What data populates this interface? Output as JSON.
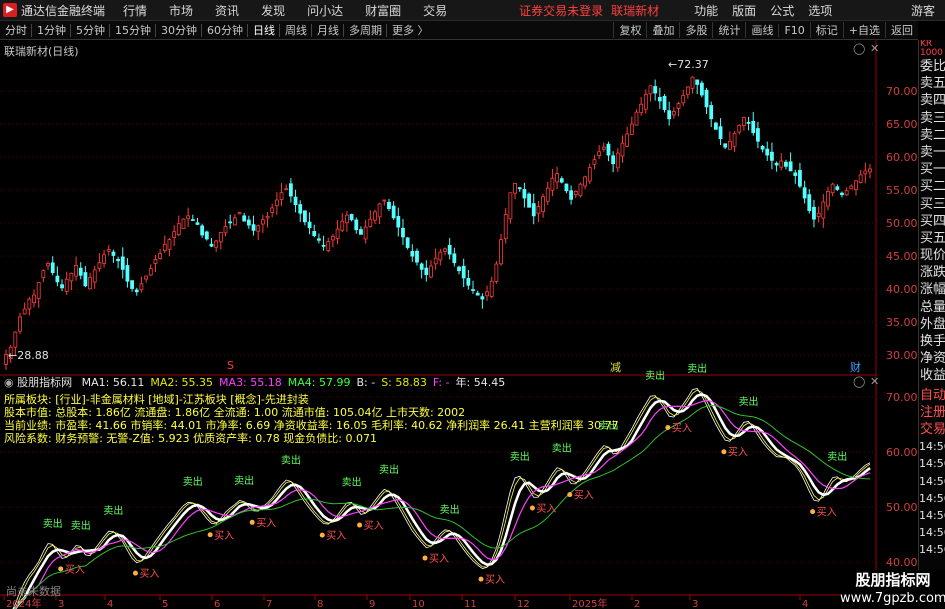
{
  "app": {
    "title": "通达信金融终端",
    "login_status": "证券交易未登录",
    "stock_name": "联瑞新材",
    "guest": "游客"
  },
  "menu": [
    "行情",
    "市场",
    "资讯",
    "发现",
    "问小达",
    "财富圈",
    "交易"
  ],
  "right_menu": [
    "功能",
    "版面",
    "公式",
    "选项"
  ],
  "periods": [
    "分时",
    "1分钟",
    "5分钟",
    "15分钟",
    "30分钟",
    "60分钟",
    "日线",
    "周线",
    "月线",
    "多周期",
    "更多 〉"
  ],
  "active_period": "日线",
  "toolbar_right": [
    "复权",
    "叠加",
    "多股",
    "统计",
    "画线",
    "F10",
    "标记",
    "+自选",
    "返回"
  ],
  "main_title": "联瑞新材(日线)",
  "price_high_label": "72.37",
  "price_low_label": "28.88",
  "event_marks": [
    "S",
    "减",
    "财"
  ],
  "indicator": {
    "name": "股朋指标网",
    "items": [
      {
        "k": "MA1:",
        "v": "56.11",
        "color": "#e8e8e8"
      },
      {
        "k": "MA2:",
        "v": "55.35",
        "color": "#e8e800"
      },
      {
        "k": "MA3:",
        "v": "55.18",
        "color": "#ff40ff"
      },
      {
        "k": "MA4:",
        "v": "57.99",
        "color": "#40ff40"
      },
      {
        "k": "B:",
        "v": "-",
        "color": "#e8e8e8"
      },
      {
        "k": "S:",
        "v": "58.83",
        "color": "#e8e800"
      },
      {
        "k": "F:",
        "v": "-",
        "color": "#ff40ff"
      },
      {
        "k": "年:",
        "v": "54.45",
        "color": "#e8e8e8"
      }
    ]
  },
  "info_lines": [
    "所属板块: [行业]-非金属材料 [地域]-江苏板块 [概念]-先进封装",
    "股本市值: 总股本: 1.86亿 流通盘: 1.86亿 全流通: 1.00 流通市值: 105.04亿 上市天数: 2002",
    "当前业绩: 市盈率: 41.66 市销率: 44.01 市净率: 6.69 净资收益率: 16.05 毛利率: 40.62 净利润率 26.41 主营利润率 30.77",
    "风险系数: 财务预警: 无警-Z值: 5.923 优质资产率: 0.78 现金负债比: 0.071"
  ],
  "no_data": "尚未未数据",
  "x_axis": [
    "2024年",
    "3",
    "4",
    "5",
    "6",
    "7",
    "8",
    "9",
    "10",
    "11",
    "12",
    "2025年",
    "2",
    "3",
    "4"
  ],
  "price_axis": [
    "70.00",
    "65.00",
    "60.00",
    "55.00",
    "50.00",
    "45.00",
    "40.00",
    "35.00",
    "30.00"
  ],
  "ind_axis": [
    "70.00",
    "60.00",
    "50.00",
    "40.00"
  ],
  "sidebar_top": [
    "KR",
    "1000"
  ],
  "sidebar": [
    "委比",
    "卖五",
    "卖四",
    "卖三",
    "卖二",
    "卖一",
    "买一",
    "买二",
    "买三",
    "买四",
    "买五",
    "现价",
    "涨跌",
    "涨幅",
    "总量",
    "外盘",
    "换手",
    "净资",
    "收益"
  ],
  "sidebar_bottom": [
    "自动",
    "注册",
    "交易"
  ],
  "sidebar_times": [
    "14:56",
    "14:56",
    "14:56",
    "14:56",
    "14:56",
    "14:56",
    "14:56"
  ],
  "signals": {
    "sell": "卖出",
    "buy": "买入"
  },
  "watermark": {
    "line1": "股朋指标网",
    "line2": "www.7gpzb.com"
  },
  "colors": {
    "up": "#ff3c3c",
    "down": "#54ffff",
    "ma_white": "#ffffff",
    "ma_yellow": "#ffff40",
    "ma_magenta": "#ff40ff",
    "ma_green": "#30c030"
  },
  "chart_data": {
    "type": "candlestick",
    "price_range": [
      27,
      75
    ],
    "indicator_range": [
      34,
      74
    ],
    "closes": [
      30.1,
      31.2,
      33.5,
      35.8,
      37.0,
      38.5,
      39.1,
      41.0,
      42.8,
      43.9,
      42.5,
      41.1,
      40.2,
      41.5,
      42.4,
      43.6,
      42.1,
      40.5,
      41.8,
      42.9,
      44.0,
      45.2,
      46.0,
      45.1,
      44.3,
      43.0,
      41.2,
      40.1,
      39.6,
      40.8,
      42.0,
      43.1,
      44.5,
      45.4,
      46.8,
      47.5,
      48.7,
      49.9,
      50.6,
      51.1,
      50.4,
      49.8,
      48.2,
      47.6,
      46.5,
      47.3,
      48.6,
      49.5,
      50.1,
      50.8,
      51.6,
      50.3,
      49.7,
      48.9,
      49.6,
      50.5,
      51.0,
      52.3,
      53.5,
      54.6,
      55.2,
      54.1,
      52.8,
      51.5,
      50.2,
      49.3,
      48.1,
      47.4,
      46.6,
      47.2,
      48.0,
      49.1,
      50.3,
      51.2,
      50.5,
      49.0,
      48.3,
      49.4,
      50.6,
      51.7,
      52.9,
      53.5,
      52.2,
      50.8,
      49.4,
      47.9,
      46.3,
      45.0,
      44.1,
      43.0,
      42.2,
      43.5,
      44.7,
      45.6,
      46.1,
      45.3,
      44.0,
      42.8,
      41.7,
      40.6,
      39.8,
      39.1,
      38.5,
      39.6,
      41.2,
      43.8,
      47.5,
      51.3,
      54.6,
      56.0,
      55.2,
      53.8,
      52.4,
      51.1,
      52.5,
      54.0,
      55.3,
      56.8,
      57.5,
      56.2,
      54.9,
      53.6,
      54.8,
      55.9,
      57.0,
      58.4,
      59.6,
      60.8,
      61.5,
      60.3,
      59.0,
      60.6,
      62.1,
      63.5,
      65.0,
      66.8,
      68.0,
      69.5,
      70.8,
      69.7,
      68.5,
      67.2,
      65.8,
      66.9,
      68.1,
      69.3,
      70.6,
      72.1,
      71.0,
      69.4,
      67.6,
      65.8,
      64.2,
      62.8,
      61.5,
      62.4,
      63.6,
      64.8,
      66.0,
      65.1,
      63.7,
      62.4,
      61.2,
      60.3,
      59.5,
      58.8,
      59.4,
      58.6,
      57.9,
      57.2,
      55.6,
      53.8,
      51.9,
      50.6,
      51.5,
      53.2,
      54.8,
      55.9,
      55.1,
      54.3,
      54.9,
      55.6,
      56.4,
      57.3,
      57.9,
      58.2
    ]
  }
}
